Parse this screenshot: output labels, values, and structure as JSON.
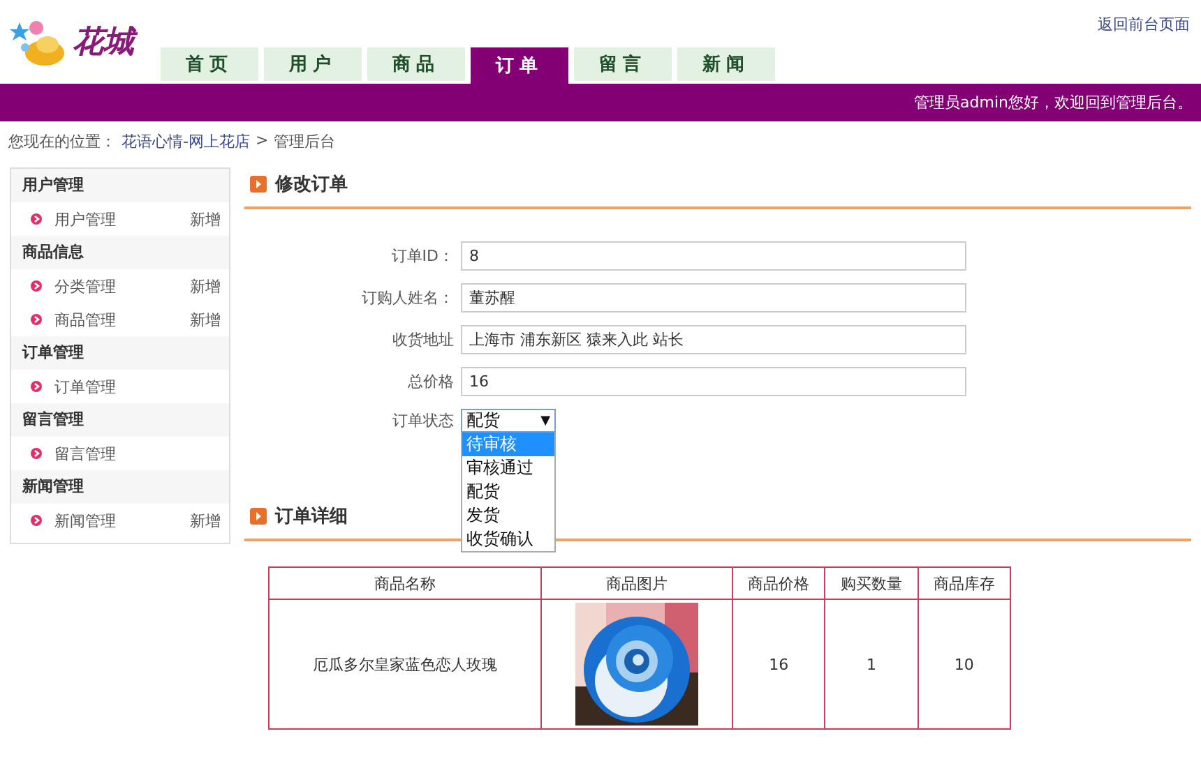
{
  "header": {
    "logo": "花城",
    "back_link": "返回前台页面",
    "nav": [
      {
        "label": "首页",
        "selected": false
      },
      {
        "label": "用户",
        "selected": false
      },
      {
        "label": "商品",
        "selected": false
      },
      {
        "label": "订单",
        "selected": true
      },
      {
        "label": "留言",
        "selected": false
      },
      {
        "label": "新闻",
        "selected": false
      }
    ],
    "welcome": "管理员admin您好，欢迎回到管理后台。"
  },
  "breadcrumb": {
    "prefix": "您现在的位置：",
    "link": "花语心情-网上花店",
    "separator": ">",
    "current": "管理后台"
  },
  "sidebar": [
    {
      "title": "用户管理",
      "items": [
        {
          "label": "用户管理",
          "action": "新增"
        }
      ]
    },
    {
      "title": "商品信息",
      "items": [
        {
          "label": "分类管理",
          "action": "新增"
        },
        {
          "label": "商品管理",
          "action": "新增"
        }
      ]
    },
    {
      "title": "订单管理",
      "items": [
        {
          "label": "订单管理"
        }
      ]
    },
    {
      "title": "留言管理",
      "items": [
        {
          "label": "留言管理"
        }
      ]
    },
    {
      "title": "新闻管理",
      "items": [
        {
          "label": "新闻管理",
          "action": "新增"
        }
      ]
    }
  ],
  "form": {
    "title": "修改订单",
    "fields": [
      {
        "label": "订单ID：",
        "value": "8"
      },
      {
        "label": "订购人姓名：",
        "value": "董苏醒"
      },
      {
        "label": "收货地址",
        "value": "上海市 浦东新区 猿来入此 站长"
      },
      {
        "label": "总价格",
        "value": "16"
      }
    ],
    "status": {
      "label": "订单状态",
      "value": "配货",
      "arrow": "▼",
      "expanded": true,
      "options": [
        {
          "label": "待审核",
          "highlighted": true
        },
        {
          "label": "审核通过",
          "highlighted": false
        },
        {
          "label": "配货",
          "highlighted": false
        },
        {
          "label": "发货",
          "highlighted": false
        },
        {
          "label": "收货确认",
          "highlighted": false
        }
      ]
    }
  },
  "details": {
    "title": "订单详细",
    "columns": [
      "商品名称",
      "商品图片",
      "商品价格",
      "购买数量",
      "商品库存"
    ],
    "rows": [
      {
        "name": "厄瓜多尔皇家蓝色恋人玫瑰",
        "price": "16",
        "quantity": "1",
        "stock": "10"
      }
    ]
  }
}
